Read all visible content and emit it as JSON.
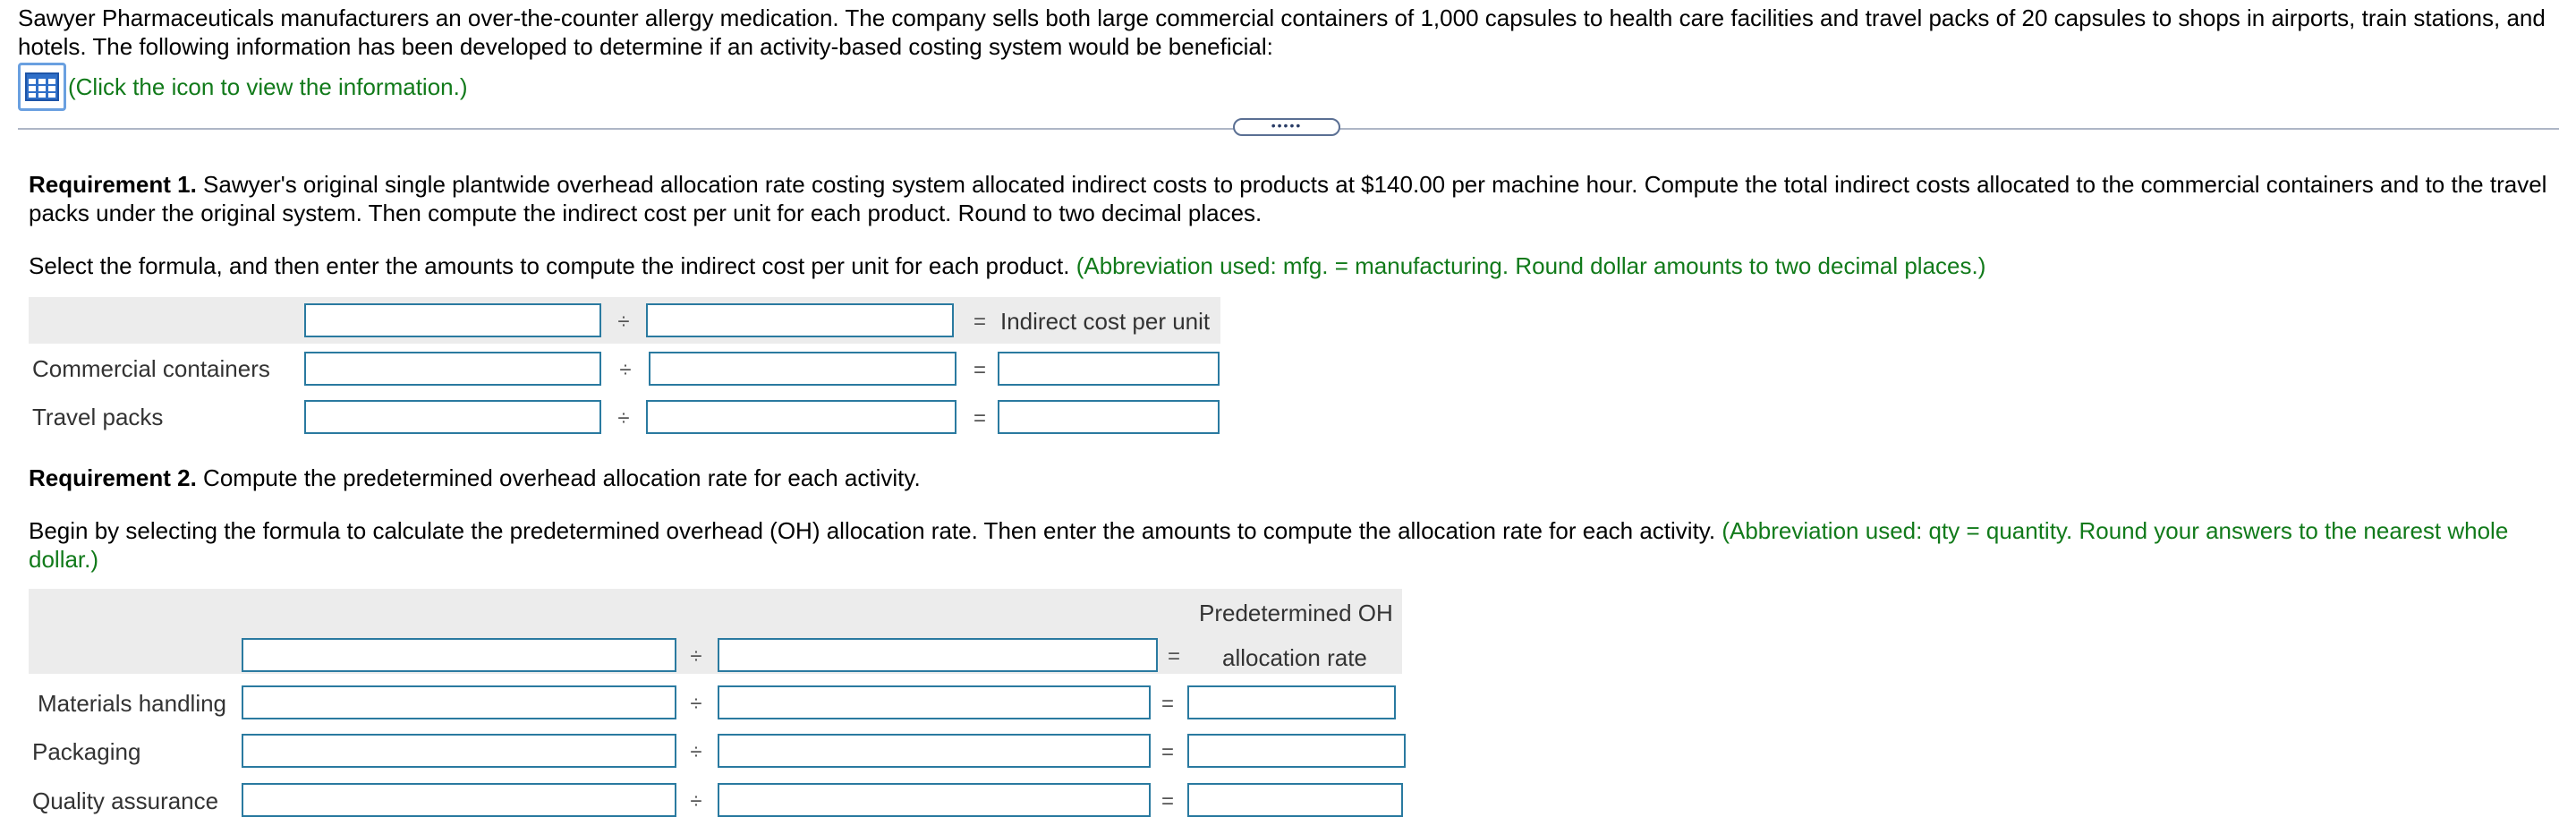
{
  "intro": {
    "text": "Sawyer Pharmaceuticals manufacturers an over-the-counter allergy medication. The company sells both large commercial containers of 1,000 capsules to health care facilities and travel packs of 20 capsules to shops in airports, train stations, and hotels. The following information has been developed to determine if an activity-based costing system would be beneficial:",
    "info_link": "(Click the icon to view the information.)",
    "expand_handle": "•••••"
  },
  "req1": {
    "heading": "Requirement 1.",
    "text": " Sawyer's original single plantwide overhead allocation rate costing system allocated indirect costs to products at $140.00 per machine hour. Compute the total indirect costs allocated to the commercial containers and to the travel packs under the original system. Then compute the indirect cost per unit for each product. Round to two decimal places.",
    "instruction": "Select the formula, and then enter the amounts to compute the indirect cost per unit for each product. ",
    "hint": "(Abbreviation used: mfg. = manufacturing. Round dollar amounts to two decimal places.)",
    "table": {
      "divide_symbol": "÷",
      "equals_symbol": "=",
      "result_header": "Indirect cost per unit",
      "rows": [
        {
          "label": "Commercial containers"
        },
        {
          "label": "Travel packs"
        }
      ]
    }
  },
  "req2": {
    "heading": "Requirement 2.",
    "text": " Compute the predetermined overhead allocation rate for each activity.",
    "instruction": "Begin by selecting the formula to calculate the predetermined overhead (OH) allocation rate. Then enter the amounts to compute the allocation rate for each activity. ",
    "hint": "(Abbreviation used: qty = quantity. Round your answers to the nearest whole dollar.)",
    "table": {
      "divide_symbol": "÷",
      "equals_symbol": "=",
      "result_header_line1": "Predetermined OH",
      "result_header_line2": "allocation rate",
      "rows": [
        {
          "label": "Materials handling"
        },
        {
          "label": "Packaging"
        },
        {
          "label": "Quality assurance"
        }
      ]
    }
  }
}
